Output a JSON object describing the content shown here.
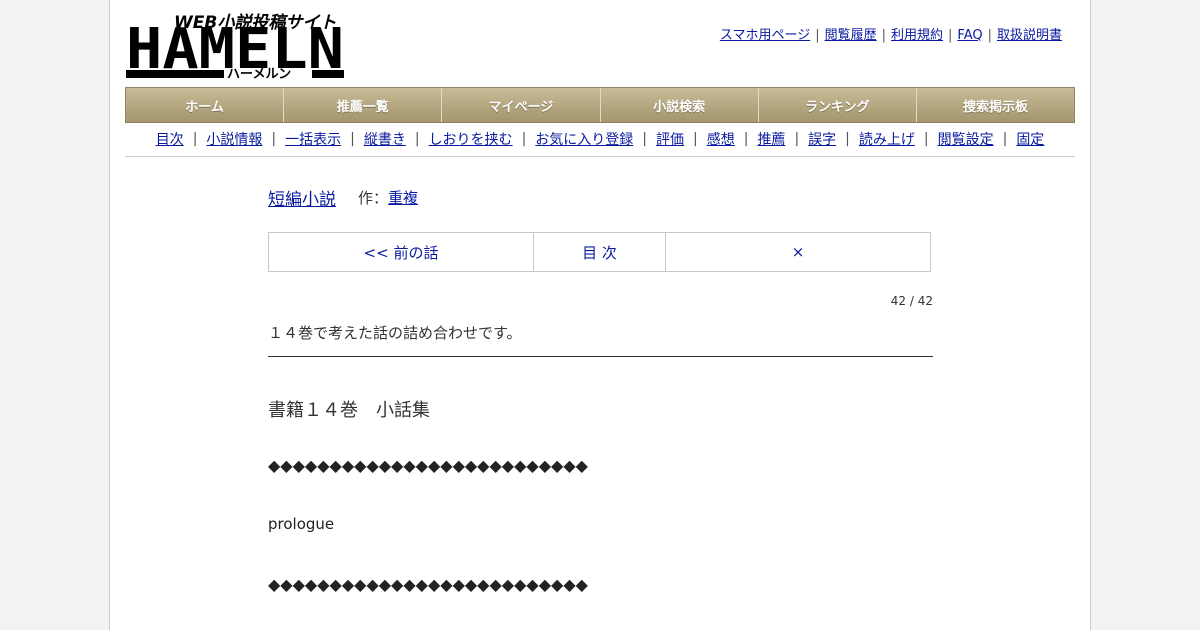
{
  "logo": {
    "tagline": "WEB小説投稿サイト",
    "name": "HAMELN",
    "kana": "ハーメルン"
  },
  "top_links": [
    "スマホ用ページ",
    "閲覧履歴",
    "利用規約",
    "FAQ",
    "取扱説明書"
  ],
  "main_nav": [
    "ホーム",
    "推薦一覧",
    "マイページ",
    "小説検索",
    "ランキング",
    "捜索掲示板"
  ],
  "sub_nav": [
    "目次",
    "小説情報",
    "一括表示",
    "縦書き",
    "しおりを挟む",
    "お気に入り登録",
    "評価",
    "感想",
    "推薦",
    "誤字",
    "読み上げ",
    "閲覧設定",
    "固定"
  ],
  "novel": {
    "title": "短編小説",
    "author_label": "作：",
    "author": "重複",
    "prev_label": "<< 前の話",
    "toc_label": "目 次",
    "close_label": "×",
    "count": "42 / 42",
    "foreword": "１４巻で考えた話の詰め合わせです。",
    "chapter_title": "書籍１４巻　小話集",
    "separator": "◆◆◆◆◆◆◆◆◆◆◆◆◆◆◆◆◆◆◆◆◆◆◆◆◆◆",
    "prologue": "prologue"
  }
}
